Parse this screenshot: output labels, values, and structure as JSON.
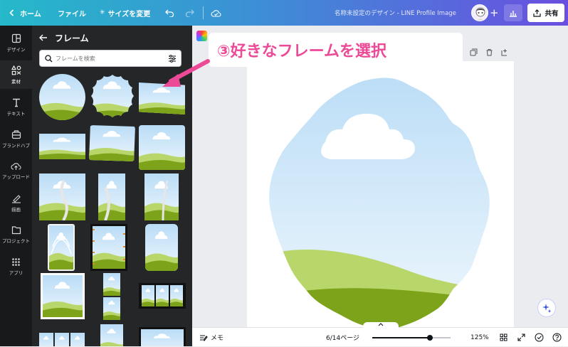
{
  "topbar": {
    "home_label": "ホーム",
    "file_label": "ファイル",
    "resize_label": "サイズを変更",
    "doc_title": "名称未設定のデザイン - LINE Profile Image",
    "share_label": "共有"
  },
  "rail": {
    "items": [
      {
        "label": "デザイン",
        "icon": "layout-icon"
      },
      {
        "label": "素材",
        "icon": "elements-icon"
      },
      {
        "label": "テキスト",
        "icon": "text-icon"
      },
      {
        "label": "ブランドハブ",
        "icon": "brand-icon"
      },
      {
        "label": "アップロード",
        "icon": "upload-icon"
      },
      {
        "label": "描画",
        "icon": "draw-icon"
      },
      {
        "label": "プロジェクト",
        "icon": "folder-icon"
      },
      {
        "label": "アプリ",
        "icon": "apps-icon"
      }
    ]
  },
  "panel": {
    "title": "フレーム",
    "search_placeholder": "フレームを検索"
  },
  "callout": {
    "text": "③好きなフレームを選択"
  },
  "bottombar": {
    "notes_label": "メモ",
    "page_indicator": "6/14ページ",
    "zoom": "125%"
  },
  "colors": {
    "accent_pink": "#ec4a96",
    "sky": "#cfe8fb",
    "grass_light": "#b9d66a",
    "grass_dark": "#7da31a"
  }
}
